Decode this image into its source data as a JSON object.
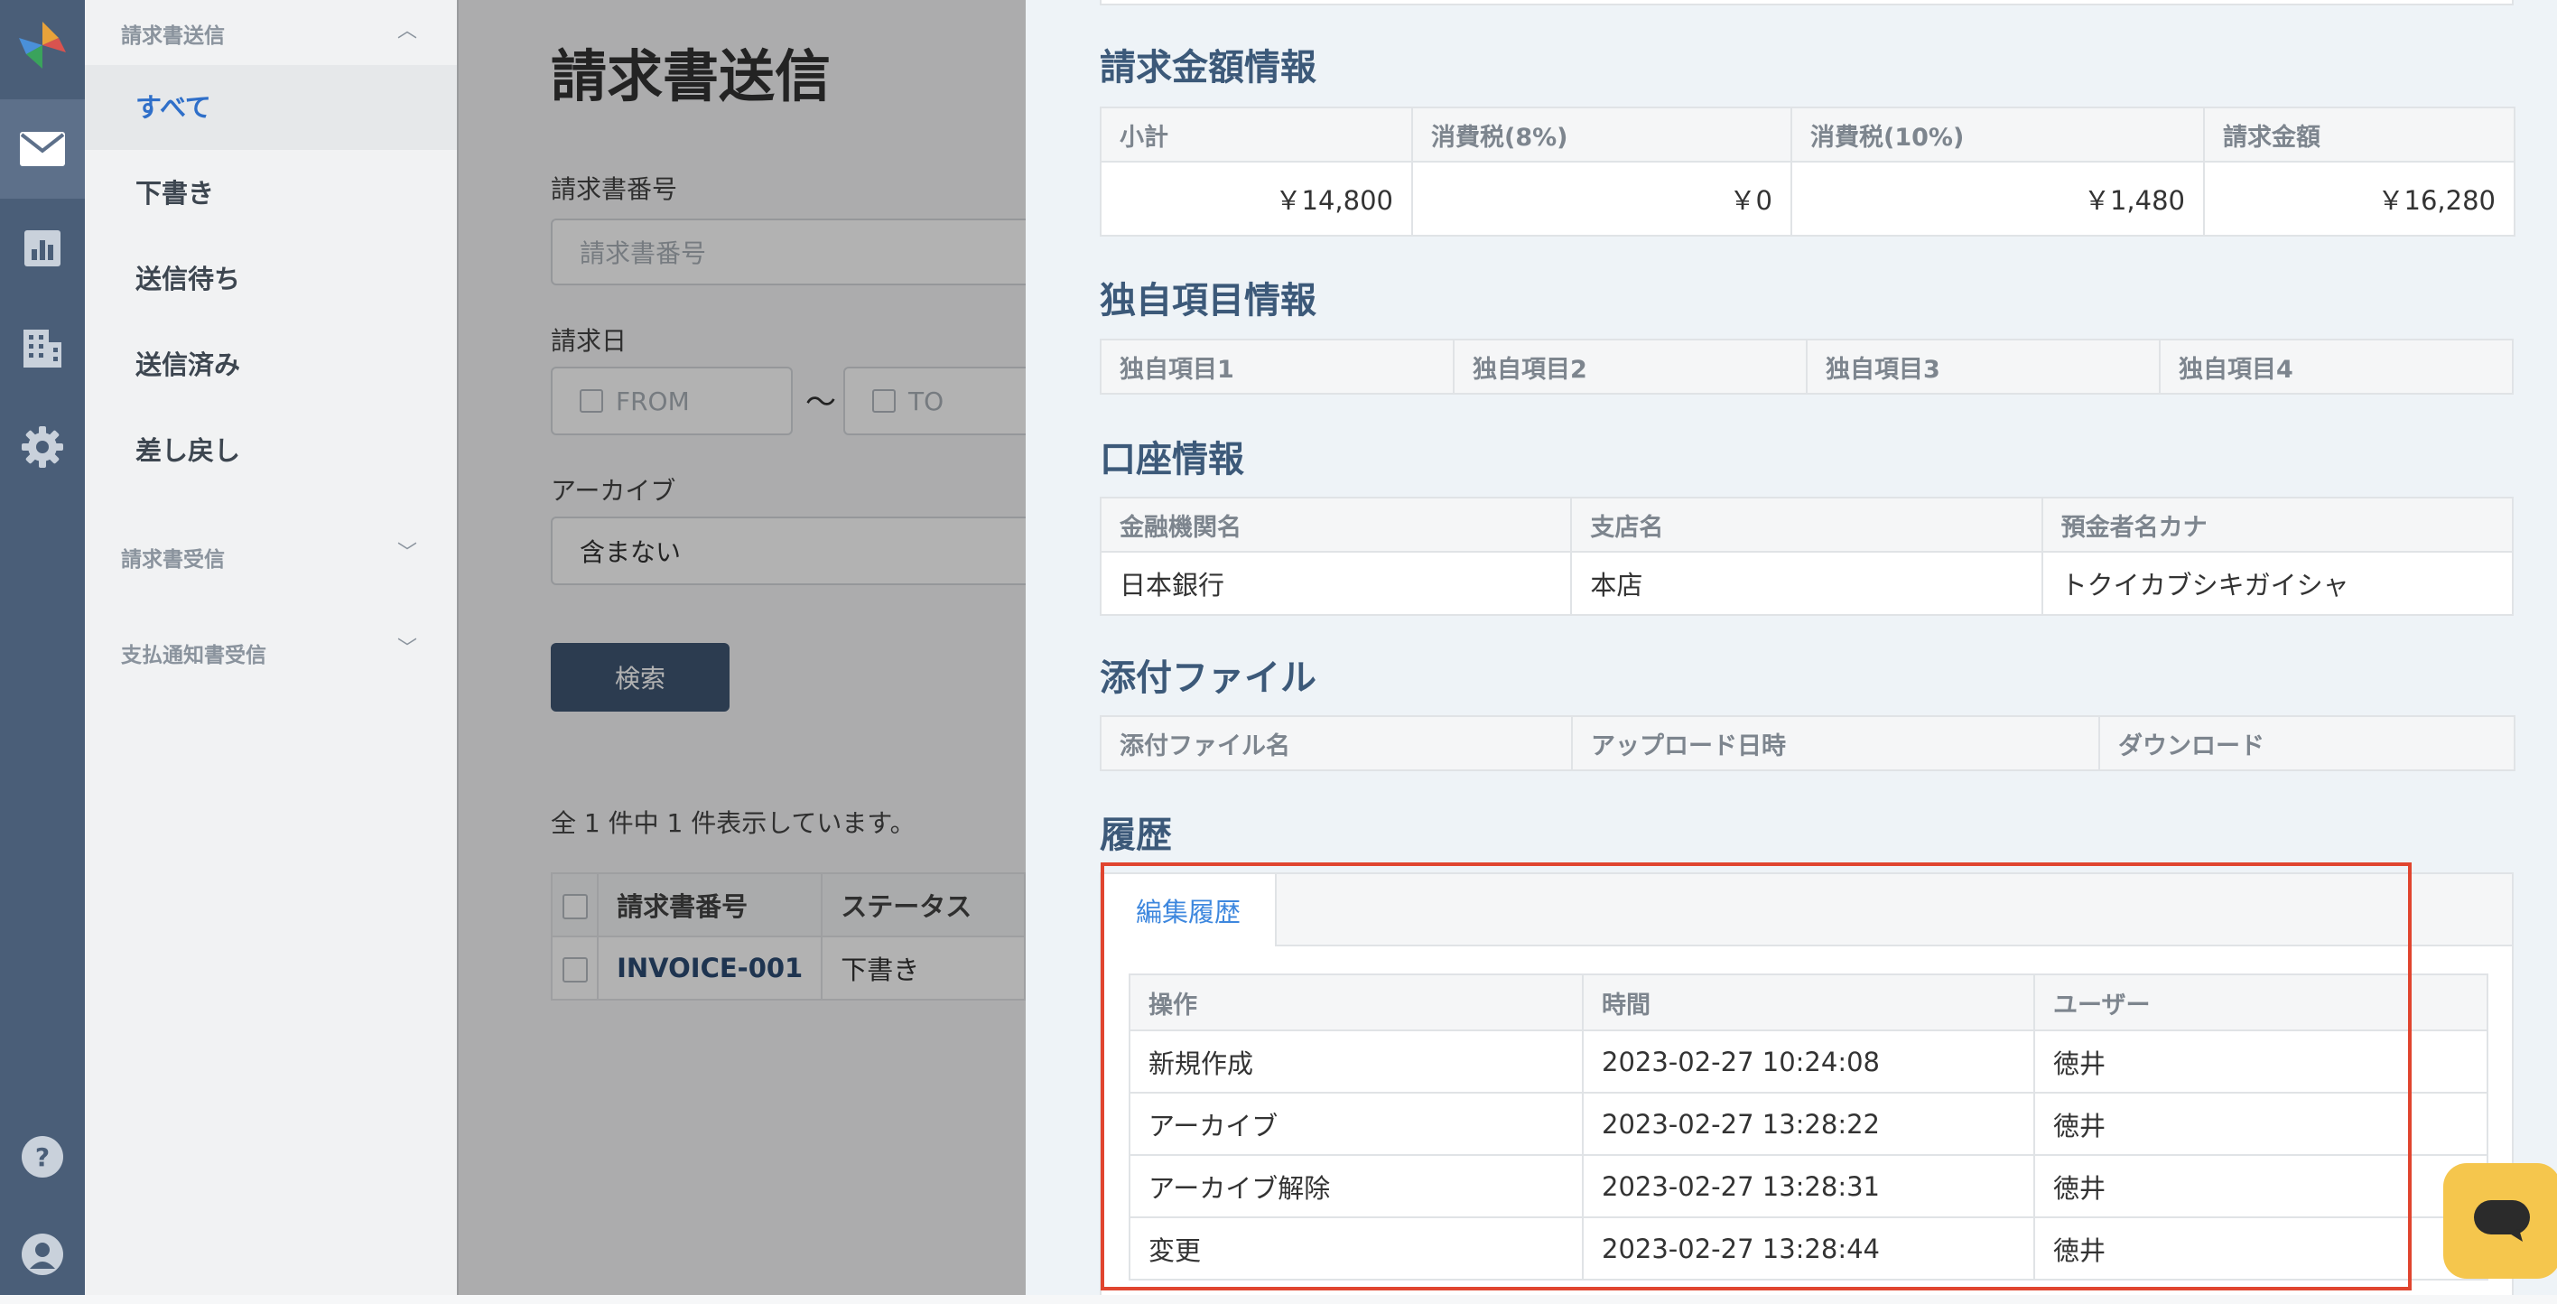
{
  "sidebar": {
    "section_send": "請求書送信",
    "items": [
      "すべて",
      "下書き",
      "送信待ち",
      "送信済み",
      "差し戻し"
    ],
    "section_receive": "請求書受信",
    "section_payment": "支払通知書受信"
  },
  "main": {
    "title": "請求書送信",
    "invoice_number_label": "請求書番号",
    "invoice_number_placeholder": "請求書番号",
    "invoice_date_label": "請求日",
    "date_from_placeholder": "FROM",
    "date_tilde": "〜",
    "date_to_placeholder": "TO",
    "archive_label": "アーカイブ",
    "archive_value": "含まない",
    "search_button": "検索",
    "result_count": "全 1 件中 1 件表示しています。",
    "table_headers": [
      "請求書番号",
      "ステータス"
    ],
    "rows": [
      {
        "invoice_no": "INVOICE-001",
        "status": "下書き"
      }
    ]
  },
  "detail": {
    "amount": {
      "title": "請求金額情報",
      "headers": [
        "小計",
        "消費税(8%)",
        "消費税(10%)",
        "請求金額"
      ],
      "values": [
        "￥14,800",
        "￥0",
        "￥1,480",
        "￥16,280"
      ]
    },
    "custom": {
      "title": "独自項目情報",
      "headers": [
        "独自項目1",
        "独自項目2",
        "独自項目3",
        "独自項目4"
      ]
    },
    "bank": {
      "title": "口座情報",
      "headers": [
        "金融機関名",
        "支店名",
        "預金者名カナ"
      ],
      "values": [
        "日本銀行",
        "本店",
        "トクイカブシキガイシャ"
      ]
    },
    "attachments": {
      "title": "添付ファイル",
      "headers": [
        "添付ファイル名",
        "アップロード日時",
        "ダウンロード"
      ]
    },
    "history": {
      "title": "履歴",
      "tab": "編集履歴",
      "headers": [
        "操作",
        "時間",
        "ユーザー"
      ],
      "rows": [
        {
          "action": "新規作成",
          "time": "2023-02-27 10:24:08",
          "user": "徳井"
        },
        {
          "action": "アーカイブ",
          "time": "2023-02-27 13:28:22",
          "user": "徳井"
        },
        {
          "action": "アーカイブ解除",
          "time": "2023-02-27 13:28:31",
          "user": "徳井"
        },
        {
          "action": "変更",
          "time": "2023-02-27 13:28:44",
          "user": "徳井"
        }
      ]
    }
  },
  "colors": {
    "rail": "#4a5e78",
    "accent": "#3d87de",
    "highlight": "#e0452f",
    "chat": "#f5c64d"
  },
  "icons": [
    "logo-icon",
    "mail-icon",
    "chart-icon",
    "building-icon",
    "gear-icon",
    "help-icon",
    "user-icon",
    "chat-icon"
  ]
}
